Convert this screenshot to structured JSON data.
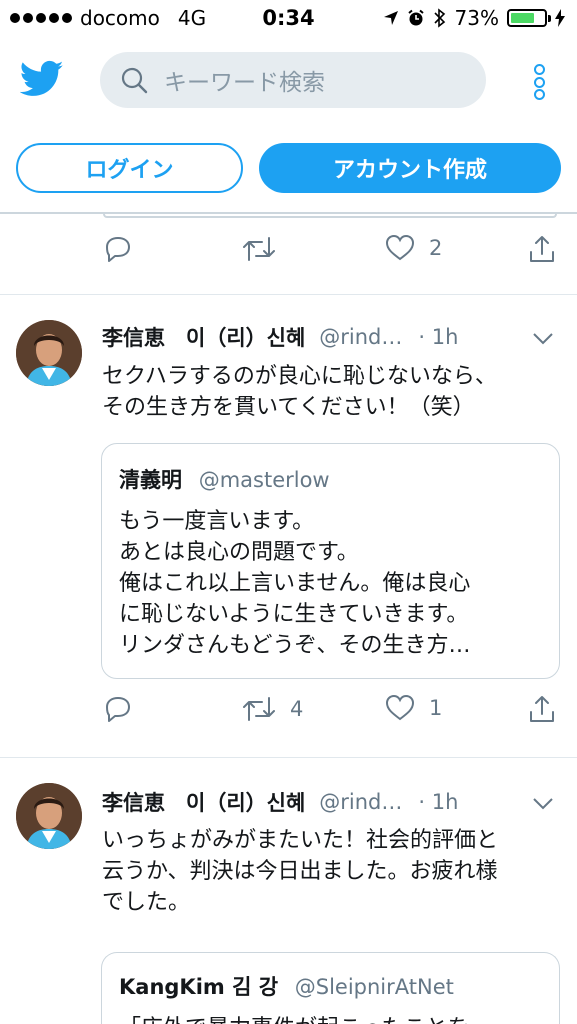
{
  "status_bar": {
    "carrier": "docomo",
    "network": "4G",
    "time": "0:34",
    "battery": "73%",
    "battery_level": 0.73
  },
  "search": {
    "placeholder": "キーワード検索",
    "icon": "search-icon"
  },
  "auth": {
    "login_label": "ログイン",
    "signup_label": "アカウント作成"
  },
  "prev_tweet": {
    "like_count": "2"
  },
  "tweets": [
    {
      "name": "李信恵　이（리）신혜",
      "handle": "@rind…",
      "time": "· 1h",
      "text_lines": [
        "セクハラするのが良心に恥じないなら、",
        "その生き方を貫いてください！（笑）"
      ],
      "quote": {
        "name": "清義明",
        "handle": "@masterlow",
        "text_lines": [
          "もう一度言います。",
          "あとは良心の問題です。",
          "俺はこれ以上言いません。俺は良心",
          "に恥じないように生きていきます。",
          "リンダさんもどうぞ、その生き方…"
        ]
      },
      "retweet_count": "4",
      "like_count": "1"
    },
    {
      "name": "李信恵　이（리）신혜",
      "handle": "@rind…",
      "time": "· 1h",
      "text_lines": [
        "いっちょがみがまたいた！社会的評価と",
        "云うか、判決は今日出ました。お疲れ様",
        "でした。"
      ],
      "quote": {
        "name": "KangKim 김 강",
        "handle": "@SleipnirAtNet",
        "text_lines": [
          "「店外で暴力事件が起こったことを"
        ]
      }
    }
  ],
  "colors": {
    "accent": "#1da1f2",
    "muted": "#657786",
    "border": "#ccd6dd",
    "search_bg": "#e6ecf0",
    "battery": "#4cd964"
  }
}
